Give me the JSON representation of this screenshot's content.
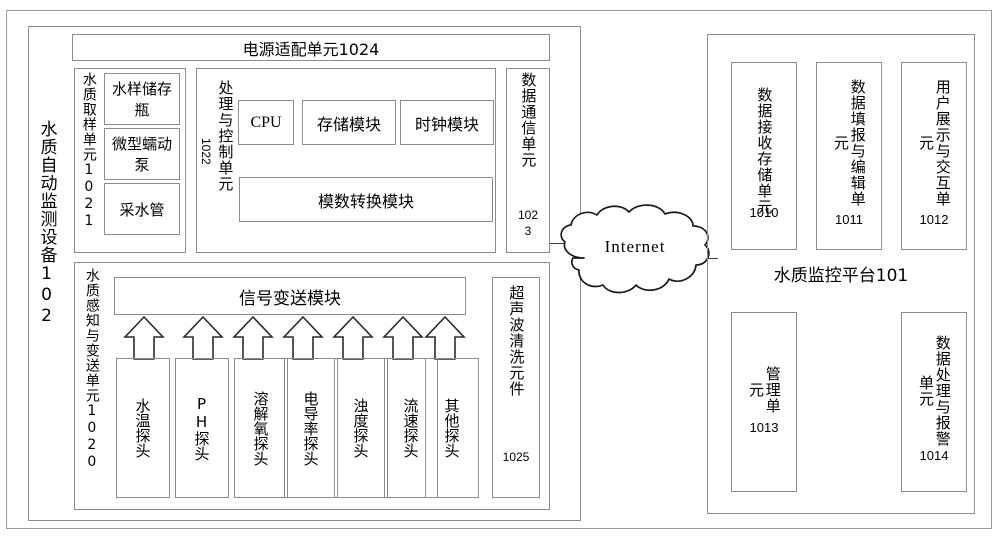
{
  "diagram": {
    "title_hidden": "",
    "device": {
      "outer_label": "水质自动监测设备102",
      "power_unit": "电源适配单元1024",
      "sampling_unit": {
        "label": "水质取样单元1021",
        "items": [
          "水样储存瓶",
          "微型蠕动泵",
          "采水管"
        ]
      },
      "control_unit": {
        "label": "处理与控制单元",
        "ref": "1022",
        "modules": [
          "CPU",
          "存储模块",
          "时钟模块"
        ],
        "wide_module": "模数转换模块"
      },
      "comm_unit": {
        "label": "数据通信单元",
        "ref_line1": "102",
        "ref_line2": "3"
      },
      "sensing_unit": {
        "label": "水质感知与变送单元1020",
        "transmitter": "信号变送模块",
        "probes": [
          "水温探头",
          "PH探头",
          "溶解氧探头",
          "电导率探头",
          "浊度探头",
          "流速探头",
          "其他探头"
        ]
      },
      "cleaner": {
        "label": "超声波清洗元件",
        "ref": "1025"
      }
    },
    "network": {
      "cloud_label": "Internet"
    },
    "platform": {
      "title": "水质监控平台101",
      "top_units": [
        {
          "label": "数据接收存储单元",
          "ref": "1010"
        },
        {
          "label": "数据填报与编辑单元",
          "ref": "1011"
        },
        {
          "label": "用户展示与交互单元",
          "ref": "1012"
        }
      ],
      "bottom_units": [
        {
          "label": "管理单元",
          "ref": "1013"
        },
        {
          "label": "数据处理与报警单元",
          "ref": "1014"
        }
      ]
    },
    "colors": {
      "line": "#8c8c8c",
      "ink": "#000000",
      "arrow": "#2b2b2b"
    }
  }
}
